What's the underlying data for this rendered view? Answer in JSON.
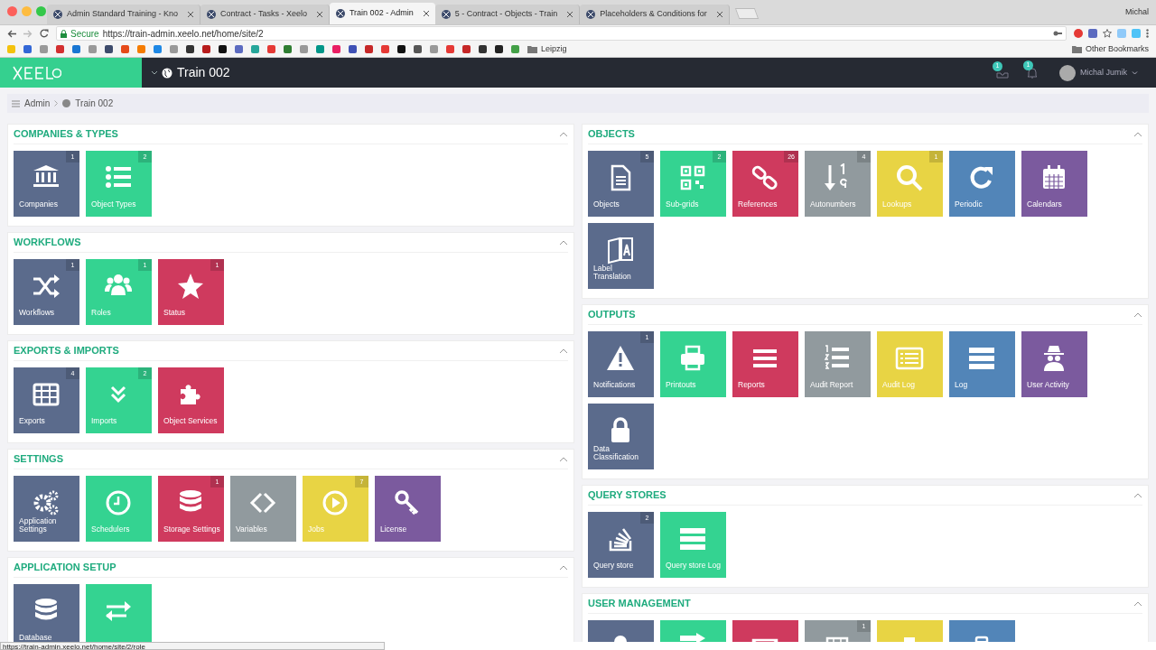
{
  "browser": {
    "tabs": [
      {
        "title": "Admin Standard Training - Kno",
        "selected": false
      },
      {
        "title": "Contract - Tasks - Xeelo",
        "selected": false
      },
      {
        "title": "Train 002 - Admin",
        "selected": true
      },
      {
        "title": "5 - Contract - Objects - Train",
        "selected": false
      },
      {
        "title": "Placeholders & Conditions for",
        "selected": false
      }
    ],
    "profile": "Michal",
    "secure_label": "Secure",
    "url": "https://train-admin.xeelo.net/home/site/2",
    "bookmarks": [
      {
        "label": "Leipzig"
      }
    ],
    "other_bookmarks": "Other Bookmarks",
    "status_url": "https://train-admin.xeelo.net/home/site/2/role"
  },
  "header": {
    "site": "Train 002",
    "notification_badges": [
      "1",
      "1"
    ],
    "user": "Michal Jumik"
  },
  "breadcrumb": [
    "Admin",
    "Train 002"
  ],
  "left_column": [
    {
      "title": "COMPANIES & TYPES",
      "expanded": true,
      "tiles": [
        {
          "label": "Companies",
          "badge": "1",
          "color": "#5b6b8c"
        },
        {
          "label": "Object Types",
          "badge": "2",
          "color": "#34d391"
        }
      ]
    },
    {
      "title": "WORKFLOWS",
      "expanded": true,
      "tiles": [
        {
          "label": "Workflows",
          "badge": "1",
          "color": "#5b6b8c"
        },
        {
          "label": "Roles",
          "badge": "1",
          "color": "#34d391"
        },
        {
          "label": "Status",
          "badge": "1",
          "color": "#cf3a5e"
        }
      ]
    },
    {
      "title": "EXPORTS & IMPORTS",
      "expanded": true,
      "tiles": [
        {
          "label": "Exports",
          "badge": "4",
          "color": "#5b6b8c"
        },
        {
          "label": "Imports",
          "badge": "2",
          "color": "#34d391"
        },
        {
          "label": "Object Services",
          "color": "#cf3a5e"
        }
      ]
    },
    {
      "title": "SETTINGS",
      "expanded": true,
      "tiles": [
        {
          "label": "Application Settings",
          "color": "#5b6b8c"
        },
        {
          "label": "Schedulers",
          "color": "#34d391"
        },
        {
          "label": "Storage Settings",
          "badge": "1",
          "color": "#cf3a5e"
        },
        {
          "label": "Variables",
          "color": "#919a9e"
        },
        {
          "label": "Jobs",
          "badge": "7",
          "color": "#e8d444"
        },
        {
          "label": "License",
          "color": "#7b5a9e"
        }
      ]
    },
    {
      "title": "APPLICATION SETUP",
      "expanded": true,
      "tiles": [
        {
          "label": "Database",
          "color": "#5b6b8c"
        },
        {
          "color": "#34d391"
        }
      ]
    }
  ],
  "right_column": [
    {
      "title": "OBJECTS",
      "expanded": true,
      "tiles": [
        {
          "label": "Objects",
          "badge": "5",
          "color": "#5b6b8c"
        },
        {
          "label": "Sub-grids",
          "badge": "2",
          "color": "#34d391"
        },
        {
          "label": "References",
          "badge": "26",
          "color": "#cf3a5e"
        },
        {
          "label": "Autonumbers",
          "badge": "4",
          "color": "#919a9e"
        },
        {
          "label": "Lookups",
          "badge": "1",
          "color": "#e8d444"
        },
        {
          "label": "Periodic",
          "color": "#5285b8"
        },
        {
          "label": "Calendars",
          "color": "#7b5a9e"
        },
        {
          "label": "Label Translation",
          "color": "#5b6b8c"
        }
      ]
    },
    {
      "title": "OUTPUTS",
      "expanded": true,
      "tiles": [
        {
          "label": "Notifications",
          "badge": "1",
          "color": "#5b6b8c"
        },
        {
          "label": "Printouts",
          "color": "#34d391"
        },
        {
          "label": "Reports",
          "color": "#cf3a5e"
        },
        {
          "label": "Audit Report",
          "color": "#919a9e"
        },
        {
          "label": "Audit Log",
          "color": "#e8d444"
        },
        {
          "label": "Log",
          "color": "#5285b8"
        },
        {
          "label": "User Activity",
          "color": "#7b5a9e"
        },
        {
          "label": "Data Classification",
          "color": "#5b6b8c"
        }
      ]
    },
    {
      "title": "QUERY STORES",
      "expanded": true,
      "tiles": [
        {
          "label": "Query store",
          "badge": "2",
          "color": "#5b6b8c"
        },
        {
          "label": "Query store Log",
          "color": "#34d391"
        }
      ]
    },
    {
      "title": "USER MANAGEMENT",
      "expanded": true,
      "tiles": [
        {
          "color": "#5b6b8c"
        },
        {
          "color": "#34d391"
        },
        {
          "color": "#cf3a5e"
        },
        {
          "badge": "1",
          "color": "#919a9e"
        },
        {
          "color": "#e8d444"
        },
        {
          "color": "#5285b8"
        }
      ]
    }
  ]
}
